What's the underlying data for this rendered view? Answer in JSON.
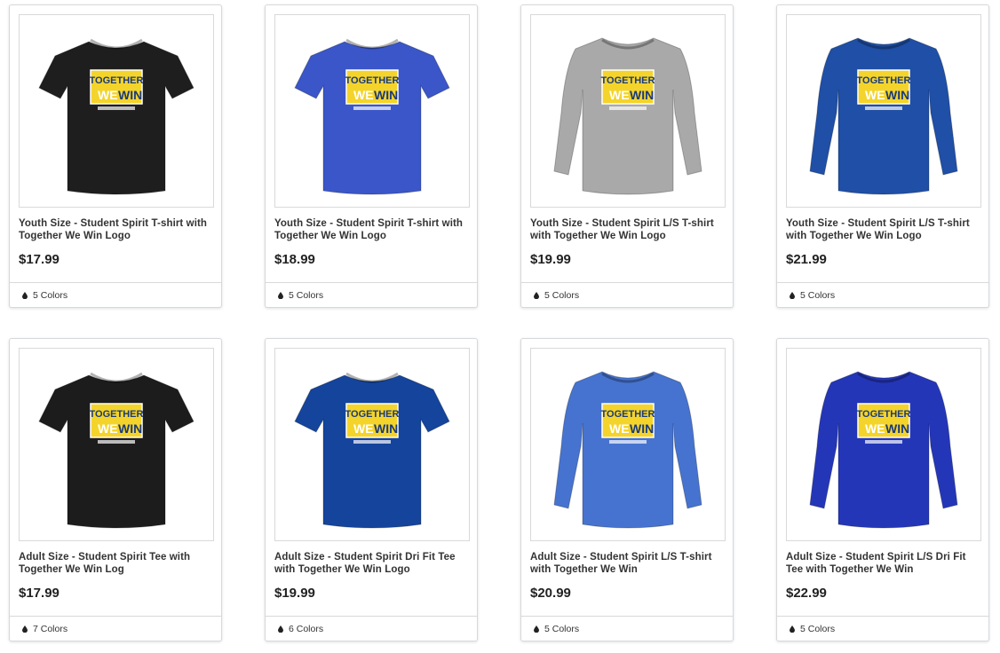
{
  "products": [
    {
      "title": "Youth Size - Student Spirit T-shirt with Together We Win Logo",
      "price": "$17.99",
      "colors": "5 Colors",
      "shirt_color": "#1e1e1e",
      "sleeve": "short"
    },
    {
      "title": "Youth Size - Student Spirit T-shirt with Together We Win Logo",
      "price": "$18.99",
      "colors": "5 Colors",
      "shirt_color": "#3a56c9",
      "sleeve": "short"
    },
    {
      "title": "Youth Size - Student Spirit L/S T-shirt with Together We Win Logo",
      "price": "$19.99",
      "colors": "5 Colors",
      "shirt_color": "#a9a9a9",
      "sleeve": "long"
    },
    {
      "title": "Youth Size - Student Spirit L/S T-shirt with Together We Win Logo",
      "price": "$21.99",
      "colors": "5 Colors",
      "shirt_color": "#1f4fa6",
      "sleeve": "long"
    },
    {
      "title": "Adult Size - Student Spirit Tee with Together We Win Log",
      "price": "$17.99",
      "colors": "7 Colors",
      "shirt_color": "#1c1c1c",
      "sleeve": "short"
    },
    {
      "title": "Adult Size - Student Spirit Dri Fit Tee with Together We Win Logo",
      "price": "$19.99",
      "colors": "6 Colors",
      "shirt_color": "#14449c",
      "sleeve": "short"
    },
    {
      "title": "Adult Size - Student Spirit L/S T-shirt with Together We Win",
      "price": "$20.99",
      "colors": "5 Colors",
      "shirt_color": "#4673cf",
      "sleeve": "long"
    },
    {
      "title": "Adult Size - Student Spirit L/S Dri Fit Tee with Together We Win",
      "price": "$22.99",
      "colors": "5 Colors",
      "shirt_color": "#2436b8",
      "sleeve": "long"
    }
  ],
  "logo": {
    "line1": "TOGETHER",
    "line2a": "WE",
    "line2b": "WIN"
  },
  "icons": {
    "colors": "droplet-icon"
  }
}
